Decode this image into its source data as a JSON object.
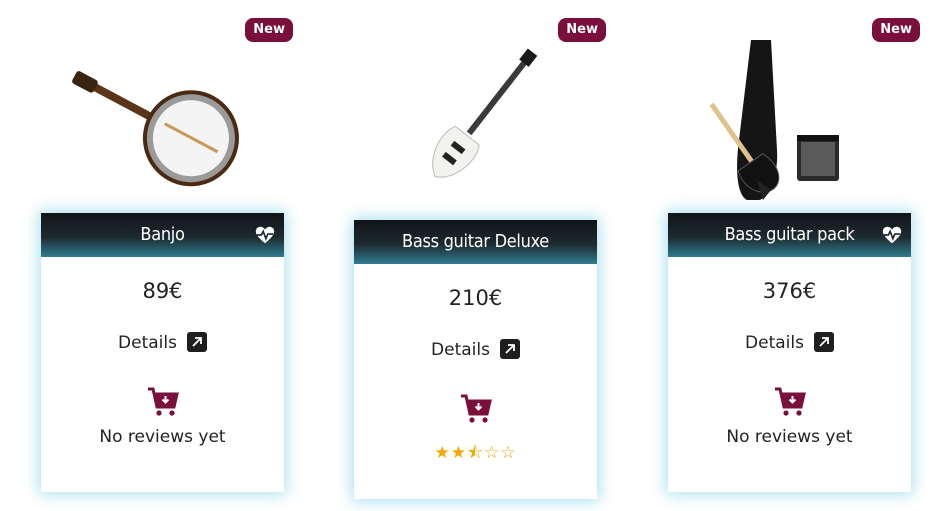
{
  "badge_label": "New",
  "details_label": "Details",
  "no_reviews_label": "No reviews yet",
  "accent_color": "#7a0f3b",
  "rating_color": "#f1a800",
  "products": [
    {
      "name": "Banjo",
      "price": "89€",
      "image": "banjo",
      "reviews": "No reviews yet"
    },
    {
      "name": "Bass guitar Deluxe",
      "price": "210€",
      "image": "bass-guitar",
      "rating": 2.5,
      "rating_max": 5,
      "stars": "★★⯪☆☆"
    },
    {
      "name": "Bass guitar pack",
      "price": "376€",
      "image": "bass-guitar-pack",
      "reviews": "No reviews yet"
    }
  ]
}
